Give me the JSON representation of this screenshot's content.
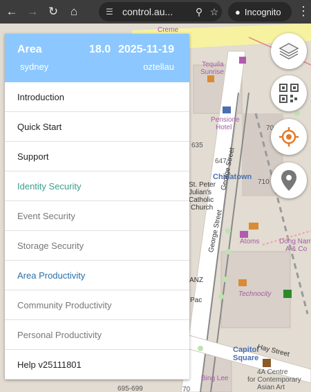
{
  "browser": {
    "url": "control.au...",
    "incognito_label": "Incognito",
    "icons": [
      "back-icon",
      "forward-icon",
      "reload-icon",
      "home-icon",
      "site-info-icon",
      "location-icon",
      "star-icon",
      "incognito-icon",
      "menu-icon"
    ]
  },
  "panel": {
    "title": "Area",
    "version": "18.0",
    "date": "2025-11-19",
    "location": "sydney",
    "user": "oztellau",
    "items": [
      {
        "label": "Introduction",
        "style": "normal"
      },
      {
        "label": "Quick Start",
        "style": "normal"
      },
      {
        "label": "Support",
        "style": "normal"
      },
      {
        "label": "Identity Security",
        "style": "teal"
      },
      {
        "label": "Event Security",
        "style": "grey"
      },
      {
        "label": "Storage Security",
        "style": "grey"
      },
      {
        "label": "Area Productivity",
        "style": "blue"
      },
      {
        "label": "Community Productivity",
        "style": "grey"
      },
      {
        "label": "Personal Productivity",
        "style": "grey"
      },
      {
        "label": "Help v25111801",
        "style": "normal"
      }
    ]
  },
  "map": {
    "labels": {
      "creme": "Creme",
      "tequila": "Tequila",
      "sunrise": "Sunrise",
      "pensione": "Pensione",
      "hotel": "Hotel",
      "n635": "635",
      "n647": "647",
      "n70": "70",
      "n710": "710",
      "chinatown": "Chinatown",
      "st_peter": "St. Peter",
      "julians": "Julian's",
      "catholic": "Catholic",
      "church": "Church",
      "george_street_1": "George Street",
      "george_street_2": "George Street",
      "atoms": "Atoms",
      "dong_nam": "Dong Nam",
      "a_co": "A & Co",
      "technocity": "Technocity",
      "anz": "ANZ",
      "pac": "Pac",
      "capitol": "Capitol",
      "square": "Square",
      "hay_street": "Hay Street",
      "bing_lee": "Bing Lee",
      "centre_1": "4A Centre",
      "centre_2": "for Contemporary",
      "centre_3": "Asian Art",
      "n695699": "695-699",
      "n70b": "70"
    }
  },
  "controls": {
    "layers": "layers-icon",
    "qr": "qr-code-icon",
    "locate": "locate-icon",
    "pin": "map-pin-icon"
  }
}
